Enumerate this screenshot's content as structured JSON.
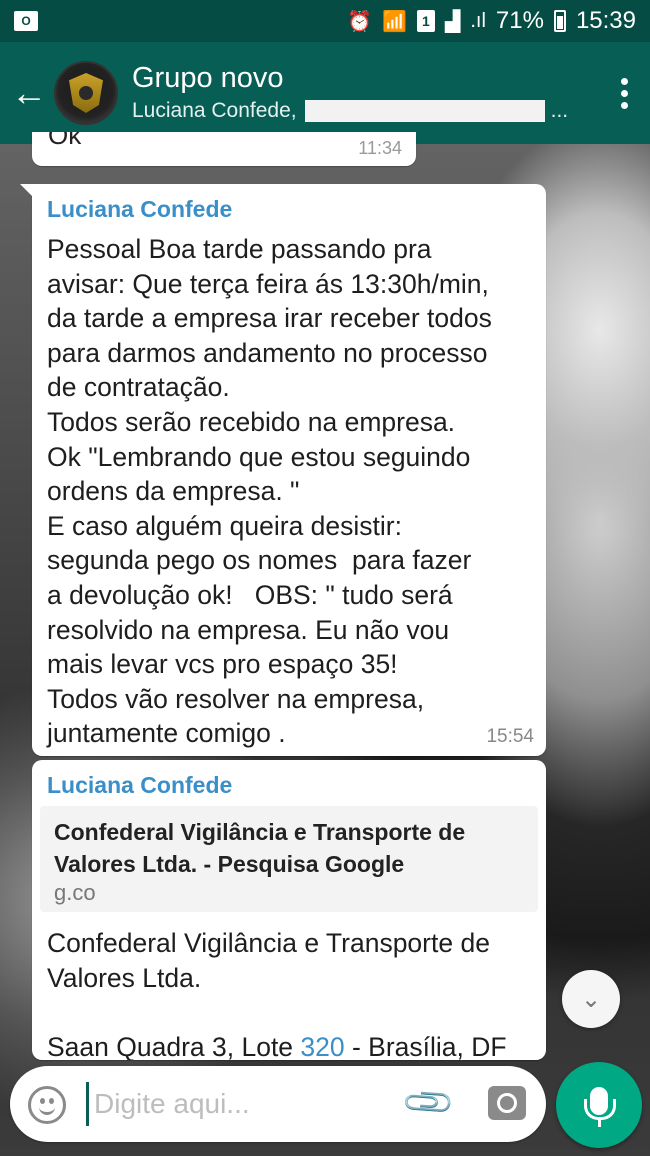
{
  "status_bar": {
    "app_icon_label": "O",
    "battery": "71%",
    "time": "15:39",
    "sim": "1"
  },
  "header": {
    "title": "Grupo novo",
    "subtitle_prefix": "Luciana Confede, ",
    "subtitle_suffix": "..."
  },
  "messages": [
    {
      "text": "Ok",
      "time": "11:34"
    },
    {
      "sender": "Luciana Confede",
      "text": "Pessoal Boa tarde passando pra\navisar: Que terça feira ás 13:30h/min,\nda tarde a empresa irar receber todos\npara darmos andamento no processo\nde contratação.\nTodos serão recebido na empresa.\nOk \"Lembrando que estou seguindo\nordens da empresa. \"\nE caso alguém queira desistir:\nsegunda pego os nomes  para fazer\na devolução ok!   OBS: \" tudo será\nresolvido na empresa. Eu não vou\nmais levar vcs pro espaço 35!\nTodos vão resolver na empresa,\njuntamente comigo .",
      "time": "15:54"
    },
    {
      "sender": "Luciana Confede",
      "link_title": "Confederal Vigilância e Transporte de Valores Ltda. - Pesquisa Google",
      "link_domain": "g.co",
      "text": "Confederal Vigilância e Transporte de Valores Ltda.",
      "text2_before": "Saan Quadra 3, Lote ",
      "text2_number": "320",
      "text2_after": " - Brasília, DF"
    }
  ],
  "input": {
    "placeholder": "Digite aqui..."
  },
  "colors": {
    "header": "#075e54",
    "status_bar": "#054d44",
    "sender_name": "#3b8fc9",
    "mic_button": "#00a884"
  },
  "icons": [
    "back-arrow-icon",
    "group-avatar",
    "overflow-menu-icon",
    "emoji-icon",
    "attach-icon",
    "camera-icon",
    "mic-icon",
    "scroll-down-icon"
  ]
}
